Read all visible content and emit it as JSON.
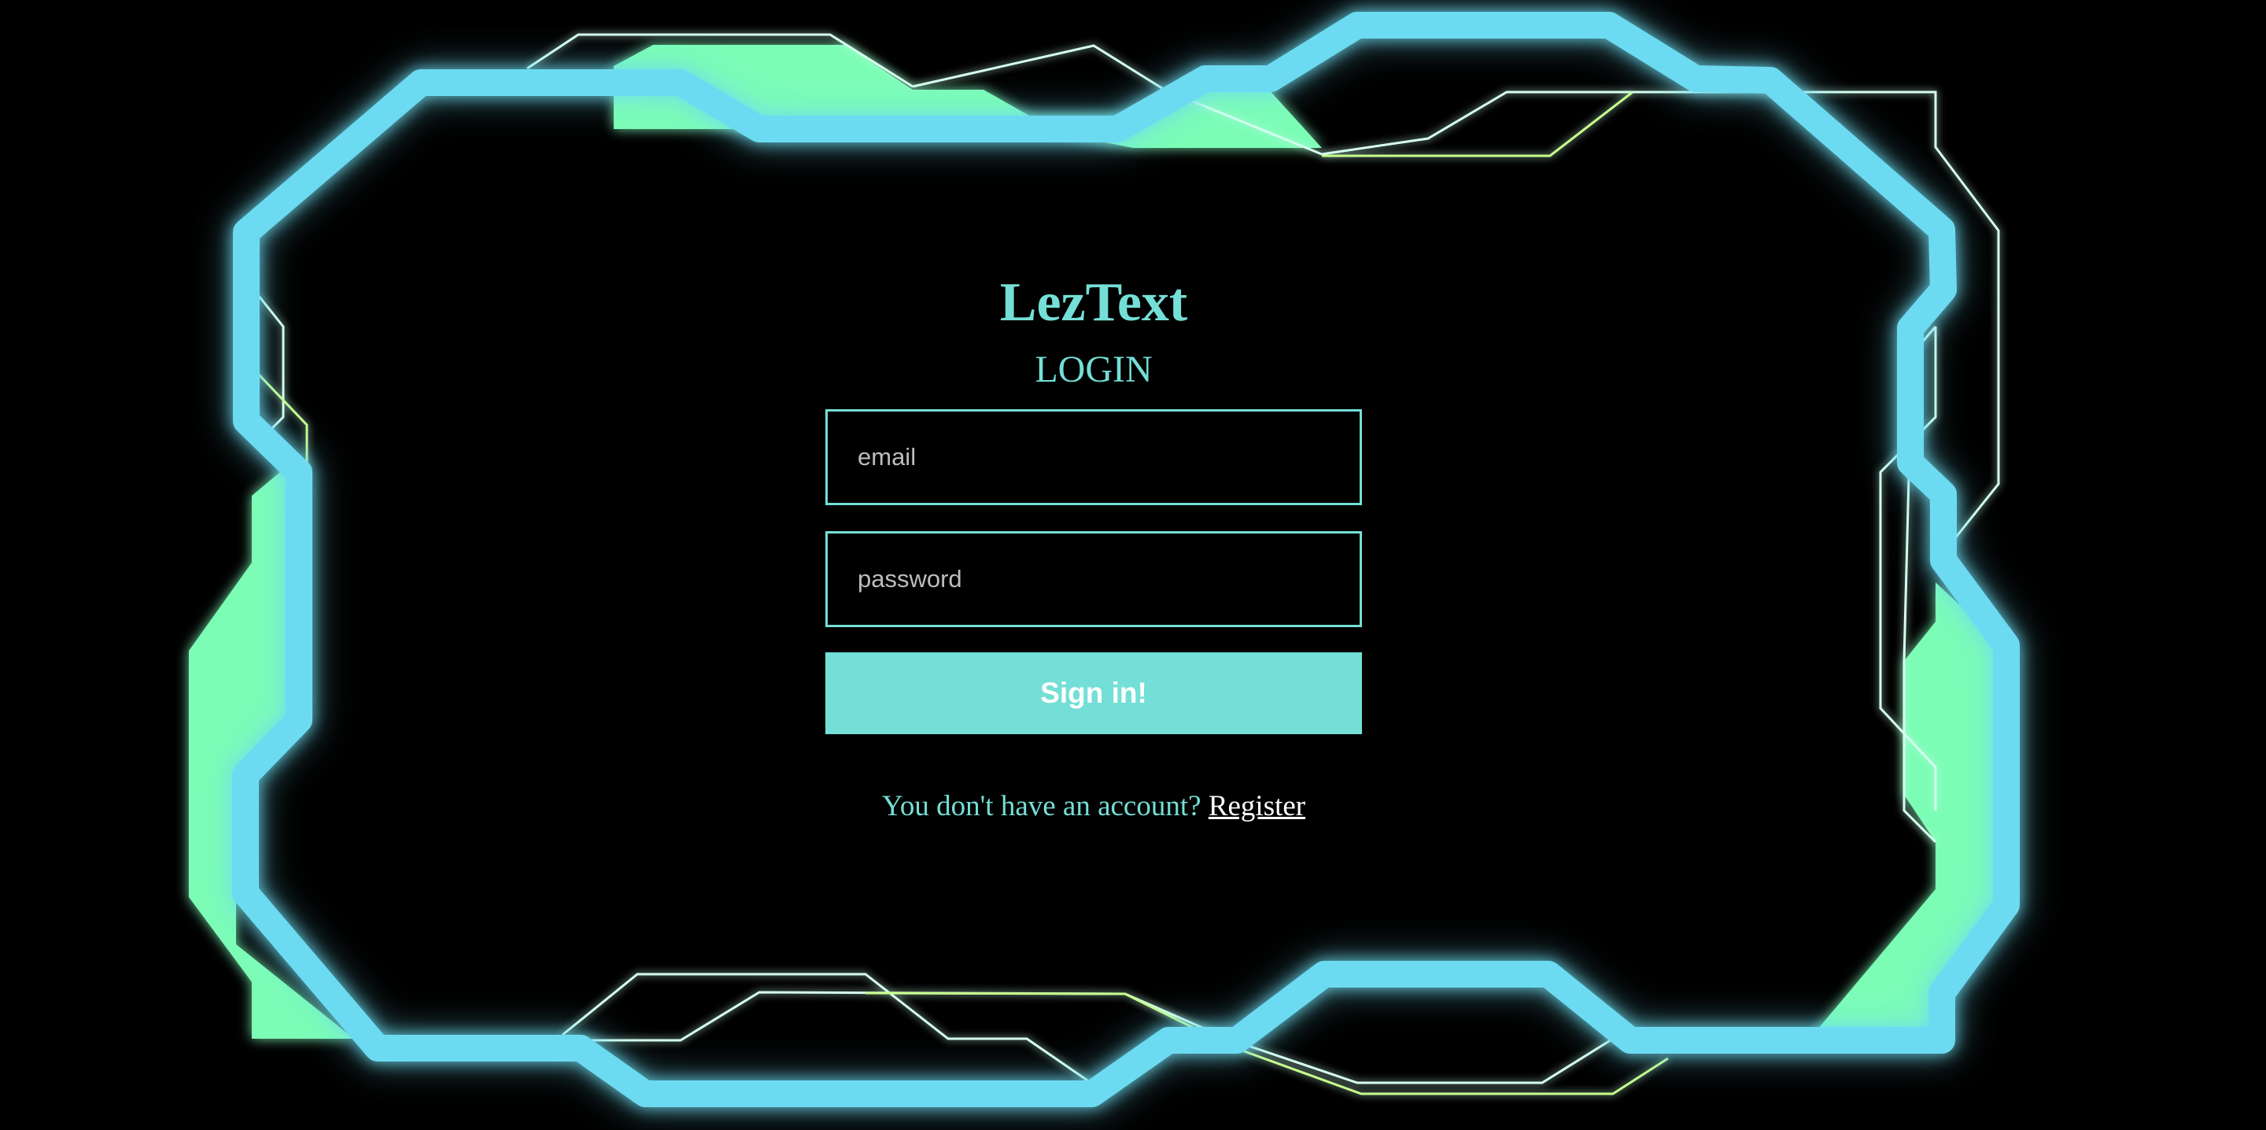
{
  "app": {
    "title": "LezText",
    "heading": "LOGIN"
  },
  "form": {
    "email_placeholder": "email",
    "password_placeholder": "password",
    "submit_label": "Sign in!"
  },
  "footer": {
    "prompt": "You don't have an account?",
    "register_link": "Register"
  },
  "theme": {
    "background": "#000000",
    "frame_blue": "#6cdbf2",
    "accent_green": "#7cfdb6",
    "text_teal": "#74dfd6",
    "link_white": "#ffffff",
    "line_yellow_green": "#c8ff8c"
  }
}
